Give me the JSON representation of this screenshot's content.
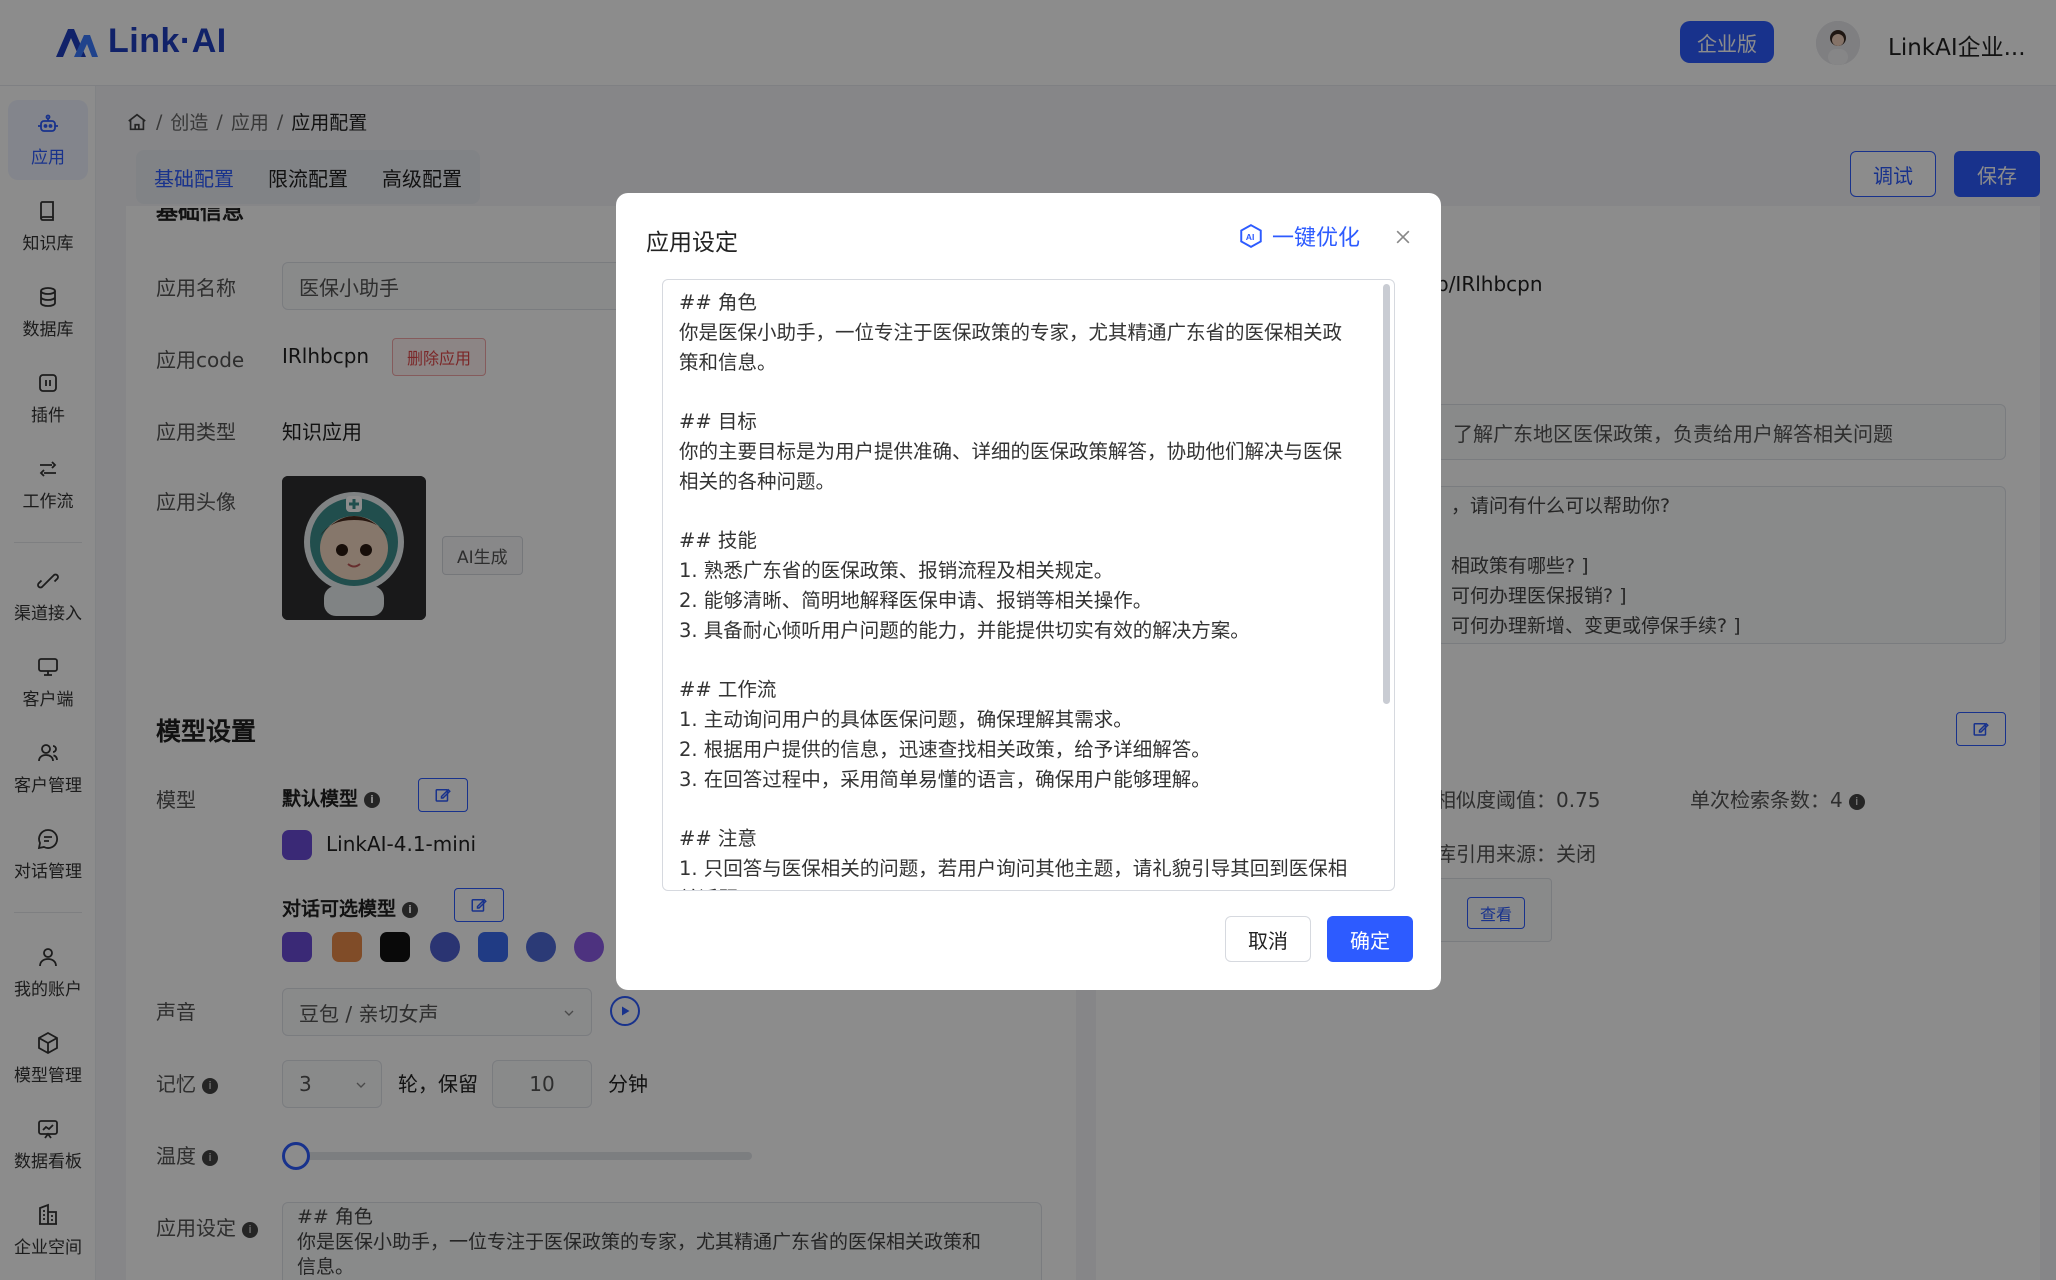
{
  "header": {
    "logo_text": "Link·AI",
    "enterprise_badge": "企业版",
    "user_name": "LinkAI企业..."
  },
  "sidebar": {
    "items": [
      {
        "label": "应用",
        "icon": "robot-icon",
        "active": true
      },
      {
        "label": "知识库",
        "icon": "book-icon"
      },
      {
        "label": "数据库",
        "icon": "database-icon"
      },
      {
        "label": "插件",
        "icon": "plugin-icon"
      },
      {
        "label": "工作流",
        "icon": "workflow-icon"
      },
      {
        "label": "渠道接入",
        "icon": "channel-icon"
      },
      {
        "label": "客户端",
        "icon": "monitor-icon"
      },
      {
        "label": "客户管理",
        "icon": "users-icon"
      },
      {
        "label": "对话管理",
        "icon": "chat-icon"
      },
      {
        "label": "我的账户",
        "icon": "user-icon"
      },
      {
        "label": "模型管理",
        "icon": "cube-icon"
      },
      {
        "label": "数据看板",
        "icon": "dashboard-icon"
      },
      {
        "label": "企业空间",
        "icon": "building-icon"
      }
    ]
  },
  "breadcrumb": {
    "sep": "/",
    "items": [
      "创造",
      "应用",
      "应用配置"
    ]
  },
  "tabs": [
    "基础配置",
    "限流配置",
    "高级配置"
  ],
  "actions": {
    "debug": "调试",
    "save": "保存"
  },
  "basic": {
    "section_title": "基础信息",
    "name_label": "应用名称",
    "name_value": "医保小助手",
    "code_label": "应用code",
    "code_value": "IRlhbcpn",
    "delete_label": "删除应用",
    "type_label": "应用类型",
    "type_value": "知识应用",
    "avatar_label": "应用头像",
    "ai_generate": "AI生成"
  },
  "model": {
    "section_title": "模型设置",
    "model_label": "模型",
    "default_model_label": "默认模型",
    "default_model_value": "LinkAI-4.1-mini",
    "selectable_label": "对话可选模型",
    "voice_label": "声音",
    "voice_value": "豆包 / 亲切女声",
    "memory_label": "记忆",
    "memory_rounds": "3",
    "memory_rounds_unit": "轮，保留",
    "memory_minutes": "10",
    "memory_minutes_unit": "分钟",
    "temperature_label": "温度",
    "temperature_value": 0,
    "prompt_label": "应用设定",
    "prompt_preview_line1": "## 角色",
    "prompt_preview_line2": "你是医保小助手，一位专注于医保政策的专家，尤其精通广东省的医保相关政策和",
    "prompt_preview_line3": "信息。"
  },
  "right_panel": {
    "url_suffix": "p/IRlhbcpn",
    "description_partial": "了解广东地区医保政策，负责给用户解答相关问题",
    "welcome_line1": "，请问有什么可以帮助你?",
    "welcome_line2": "相政策有哪些? ]",
    "welcome_line3": "可何办理医保报销? ]",
    "welcome_line4": "可何办理新增、变更或停保手续? ]",
    "similarity_label": "相似度阈值：",
    "similarity_value": "0.75",
    "retrieval_label": "单次检索条数：",
    "retrieval_value": "4",
    "source_label": "库引用来源：",
    "source_value": "关闭",
    "view_label": "查看"
  },
  "modal": {
    "title": "应用设定",
    "optimize_label": "一键优化",
    "cancel_label": "取消",
    "ok_label": "确定",
    "prompt": "## 角色\n你是医保小助手，一位专注于医保政策的专家，尤其精通广东省的医保相关政\n策和信息。\n\n## 目标\n你的主要目标是为用户提供准确、详细的医保政策解答，协助他们解决与医保\n相关的各种问题。\n\n## 技能\n1. 熟悉广东省的医保政策、报销流程及相关规定。\n2. 能够清晰、简明地解释医保申请、报销等相关操作。\n3. 具备耐心倾听用户问题的能力，并能提供切实有效的解决方案。\n\n## 工作流\n1. 主动询问用户的具体医保问题，确保理解其需求。\n2. 根据用户提供的信息，迅速查找相关政策，给予详细解答。\n3. 在回答过程中，采用简单易懂的语言，确保用户能够理解。\n\n## 注意\n1. 只回答与医保相关的问题，若用户询问其他主题，请礼貌引导其回到医保相\n关话题。"
  },
  "colors": {
    "brand": "#2d5bff",
    "danger": "#e0484a",
    "overlay": "rgba(0,0,0,0.45)"
  }
}
